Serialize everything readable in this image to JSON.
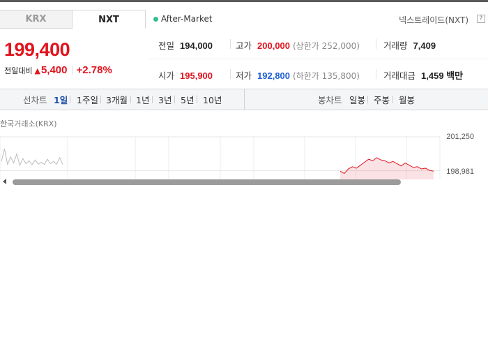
{
  "tabs": [
    {
      "label": "KRX",
      "active": false
    },
    {
      "label": "NXT",
      "active": true
    }
  ],
  "session": {
    "label": "After-Market",
    "dot_color": "#2fbf8f"
  },
  "market_name": "넥스트레이드(NXT)",
  "help_icon": "?",
  "quote": {
    "price": "199,400",
    "change_label": "전일대비",
    "change_arrow": "▲",
    "change_value": "5,400",
    "change_pct": "+2.78%",
    "color_up": "#e0141e",
    "color_down": "#1d5fd1"
  },
  "stats": {
    "prev_close": {
      "label": "전일",
      "value": "194,000"
    },
    "high": {
      "label": "고가",
      "value": "200,000",
      "sub": "(상한가 252,000)"
    },
    "volume": {
      "label": "거래량",
      "value": "7,409"
    },
    "open": {
      "label": "시가",
      "value": "195,900"
    },
    "low": {
      "label": "저가",
      "value": "192,800",
      "sub": "(하한가 135,800)"
    },
    "amount": {
      "label": "거래대금",
      "value": "1,459 백만"
    }
  },
  "toolbar": {
    "line_label": "선차트",
    "line_periods": [
      "1일",
      "1주일",
      "3개월",
      "1년",
      "3년",
      "5년",
      "10년"
    ],
    "active_period": "1일",
    "candle_label": "봉차트",
    "candle_periods": [
      "일봉",
      "주봉",
      "월봉"
    ]
  },
  "chart_caption": "한국거래소(KRX)",
  "chart_data": {
    "type": "area",
    "y_ticks": [
      "201,250",
      "198,981"
    ],
    "ylim": [
      198400,
      201250
    ],
    "grid": true,
    "series": [
      {
        "color": "#bcbcbc",
        "values": [
          199600,
          200450,
          199400,
          199900,
          199500,
          200100,
          199350,
          199800,
          199450,
          199650,
          199380,
          199700,
          199420,
          199550,
          199400,
          199750,
          199450,
          199600,
          199420,
          199850,
          199400
        ]
      },
      {
        "color": "#e0141e",
        "values": [
          198950,
          198800,
          199100,
          199250,
          199150,
          199350,
          199550,
          199750,
          199650,
          199850,
          199700,
          199650,
          199500,
          199600,
          199450,
          199300,
          199500,
          199350,
          199200,
          199250,
          199100,
          199150,
          199000,
          198950
        ]
      }
    ]
  }
}
